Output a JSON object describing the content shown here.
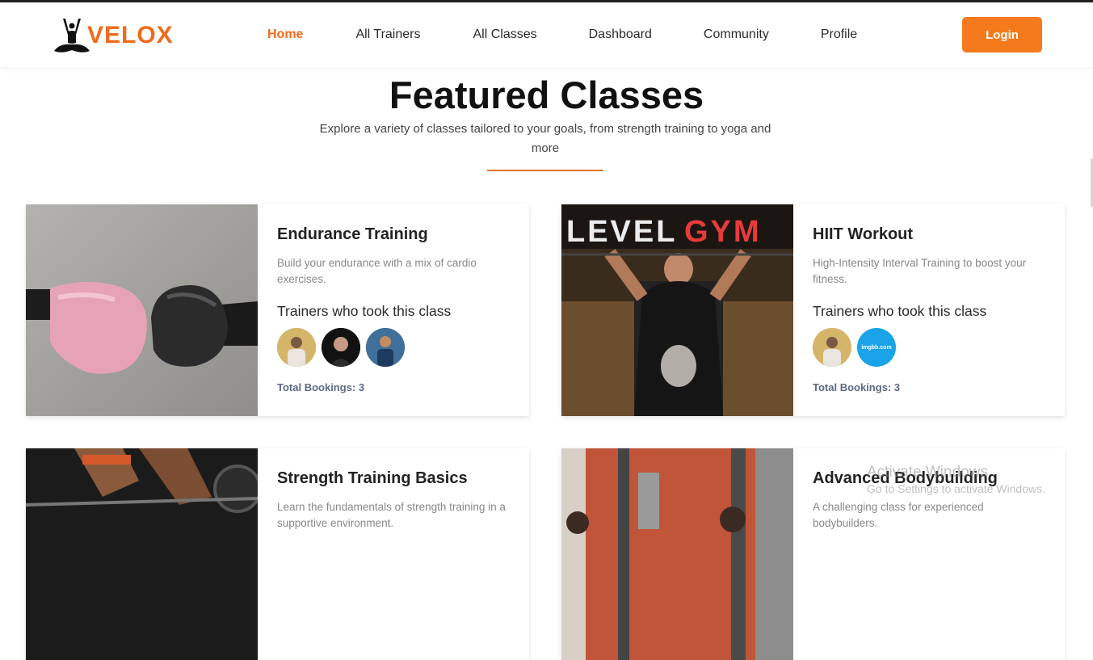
{
  "brand": {
    "name": "VELOX",
    "accent": "#f26a1b"
  },
  "nav": {
    "items": [
      {
        "label": "Home",
        "active": true
      },
      {
        "label": "All Trainers",
        "active": false
      },
      {
        "label": "All Classes",
        "active": false
      },
      {
        "label": "Dashboard",
        "active": false
      },
      {
        "label": "Community",
        "active": false
      },
      {
        "label": "Profile",
        "active": false
      }
    ],
    "login_label": "Login"
  },
  "section": {
    "title": "Featured Classes",
    "description": "Explore a variety of classes tailored to your goals, from strength training to yoga and more"
  },
  "classes": [
    {
      "title": "Endurance Training",
      "description": "Build your endurance with a mix of cardio exercises.",
      "trainers_heading": "Trainers who took this class",
      "trainer_avatars": [
        "trainer-avatar",
        "trainer-avatar",
        "trainer-avatar"
      ],
      "total_bookings": "Total Bookings: 3",
      "image": "boxing-gloves-image"
    },
    {
      "title": "HIIT Workout",
      "description": "High-Intensity Interval Training to boost your fitness.",
      "trainers_heading": "Trainers who took this class",
      "trainer_avatars": [
        "trainer-avatar",
        "imgbb-avatar"
      ],
      "imgbb_avatar_text": "imgbb.com",
      "total_bookings": "Total Bookings: 3",
      "image_text": {
        "left": "LEVEL",
        "right": "GYM"
      },
      "image": "gym-athlete-image"
    },
    {
      "title": "Strength Training Basics",
      "description": "Learn the fundamentals of strength training in a supportive environment.",
      "image": "barbell-deadlift-image"
    },
    {
      "title": "Advanced Bodybuilding",
      "description": "A challenging class for experienced bodybuilders.",
      "image": "gym-machines-image"
    }
  ],
  "watermark": {
    "title": "Activate Windows",
    "subtitle": "Go to Settings to activate Windows."
  }
}
